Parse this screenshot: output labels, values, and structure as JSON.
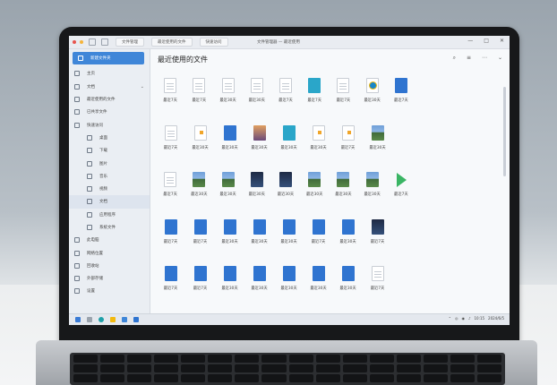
{
  "window": {
    "title": "文件管理器 — 最近使用",
    "tabs": [
      "文件管理",
      "最近使用的文件",
      "快速访问"
    ],
    "controls": [
      "—",
      "□",
      "✕"
    ]
  },
  "sidebar": {
    "items": [
      {
        "label": "新建文件夹",
        "icon": "plus-icon",
        "kind": "primary"
      },
      {
        "label": "主页",
        "icon": "home-icon"
      },
      {
        "label": "文档",
        "icon": "folder-icon",
        "chevron": "⌄"
      },
      {
        "label": "最近使用的文件",
        "icon": "clock-icon"
      },
      {
        "label": "已共享文件",
        "icon": "share-icon"
      },
      {
        "label": "快速访问",
        "icon": "star-icon"
      },
      {
        "label": "桌面",
        "icon": "desktop-icon",
        "sub": true
      },
      {
        "label": "下载",
        "icon": "download-icon",
        "sub": true
      },
      {
        "label": "图片",
        "icon": "image-icon",
        "sub": true
      },
      {
        "label": "音乐",
        "icon": "music-icon",
        "sub": true
      },
      {
        "label": "视频",
        "icon": "video-icon",
        "sub": true
      },
      {
        "label": "文档",
        "icon": "doc-icon",
        "sub": true,
        "active": true
      },
      {
        "label": "应用程序",
        "icon": "apps-icon",
        "sub": true
      },
      {
        "label": "系统文件",
        "icon": "system-icon",
        "sub": true
      },
      {
        "label": "此电脑",
        "icon": "computer-icon"
      },
      {
        "label": "网络位置",
        "icon": "network-icon"
      },
      {
        "label": "回收站",
        "icon": "trash-icon"
      },
      {
        "label": "外部存储",
        "icon": "drive-icon"
      },
      {
        "label": "设置",
        "icon": "gear-icon"
      }
    ]
  },
  "main": {
    "title": "最近使用的文件",
    "tools": [
      "⌕",
      "≡",
      "⋯",
      "⌄"
    ],
    "rows": [
      [
        {
          "type": "doc",
          "label": "最近7天"
        },
        {
          "type": "doc",
          "label": "最近7天"
        },
        {
          "type": "doc",
          "label": "最近30天"
        },
        {
          "type": "doc",
          "label": "最近30天"
        },
        {
          "type": "doc",
          "label": "最近7天"
        },
        {
          "type": "teal",
          "label": "最近7天"
        },
        {
          "type": "doc",
          "label": "最近7天"
        },
        {
          "type": "ring",
          "label": "最近30天"
        },
        {
          "type": "blue",
          "label": "最近7天"
        }
      ],
      [
        {
          "type": "doc",
          "label": "最近7天"
        },
        {
          "type": "zip",
          "label": "最近30天"
        },
        {
          "type": "blue",
          "label": "最近30天"
        },
        {
          "type": "sunset",
          "label": "最近30天"
        },
        {
          "type": "teal",
          "label": "最近30天"
        },
        {
          "type": "zip",
          "label": "最近30天"
        },
        {
          "type": "zip",
          "label": "最近7天"
        },
        {
          "type": "img",
          "label": "最近30天"
        }
      ],
      [
        {
          "type": "doc",
          "label": "最近7天"
        },
        {
          "type": "img",
          "label": "最近30天"
        },
        {
          "type": "img",
          "label": "最近30天"
        },
        {
          "type": "dark",
          "label": "最近30天"
        },
        {
          "type": "dark",
          "label": "最近30天"
        },
        {
          "type": "img",
          "label": "最近30天"
        },
        {
          "type": "img",
          "label": "最近30天"
        },
        {
          "type": "img",
          "label": "最近30天"
        },
        {
          "type": "play",
          "label": "最近7天"
        }
      ],
      [
        {
          "type": "blue",
          "label": "最近7天"
        },
        {
          "type": "blue",
          "label": "最近7天"
        },
        {
          "type": "blue",
          "label": "最近30天"
        },
        {
          "type": "blue",
          "label": "最近30天"
        },
        {
          "type": "blue",
          "label": "最近30天"
        },
        {
          "type": "blue",
          "label": "最近7天"
        },
        {
          "type": "blue",
          "label": "最近30天"
        },
        {
          "type": "dark",
          "label": "最近7天"
        }
      ],
      [
        {
          "type": "blue",
          "label": "最近7天"
        },
        {
          "type": "blue",
          "label": "最近7天"
        },
        {
          "type": "blue",
          "label": "最近30天"
        },
        {
          "type": "blue",
          "label": "最近30天"
        },
        {
          "type": "blue",
          "label": "最近30天"
        },
        {
          "type": "blue",
          "label": "最近30天"
        },
        {
          "type": "blue",
          "label": "最近30天"
        },
        {
          "type": "doc",
          "label": "最近7天"
        }
      ]
    ]
  },
  "taskbar": {
    "apps": [
      "start-icon",
      "search-icon",
      "edge-icon",
      "files-icon",
      "store-icon",
      "mail-icon"
    ],
    "tray_icons": [
      "⌃",
      "◎",
      "◉",
      "♪"
    ],
    "time": "10:15",
    "date": "2024/6/5"
  },
  "colors": {
    "accent": "#3f86d8",
    "sidebar_bg": "#eaeef3",
    "content_bg": "#f7f9fb"
  }
}
